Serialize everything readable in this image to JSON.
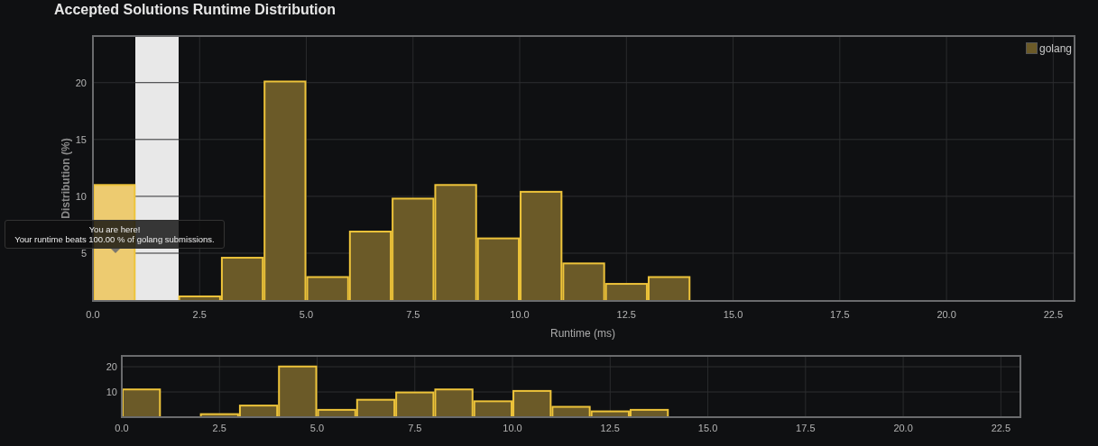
{
  "title": "Accepted Solutions Runtime Distribution",
  "tooltip": {
    "heading": "You are here!",
    "text": "Your runtime beats 100.00 % of golang submissions."
  },
  "chart": {
    "chart_data": {
      "type": "bar",
      "xlabel": "Runtime (ms)",
      "ylabel": "Distribution (%)",
      "grid": true,
      "x": [
        0.5,
        2.5,
        3.5,
        4.5,
        5.5,
        6.5,
        7.5,
        8.5,
        9.5,
        10.5,
        11.5,
        12.5,
        13.5
      ],
      "series": [
        {
          "name": "golang",
          "color": "#6b5a28",
          "values": [
            null,
            1.2,
            4.6,
            20.1,
            2.9,
            6.9,
            9.8,
            11,
            6.3,
            10.4,
            4.1,
            2.3,
            2.9
          ]
        },
        {
          "color": "#edcb70",
          "values": [
            11,
            null,
            null,
            null,
            null,
            null,
            null,
            null,
            null,
            null,
            null,
            null,
            null
          ]
        }
      ],
      "xlim": [
        0,
        23
      ],
      "ylim": [
        0.8,
        24.1
      ],
      "xticks": [
        {
          "value": 0,
          "label": "0.0"
        },
        {
          "value": 2.5,
          "label": "2.5"
        },
        {
          "value": 5,
          "label": "5.0"
        },
        {
          "value": 7.5,
          "label": "7.5"
        },
        {
          "value": 10,
          "label": "10.0"
        },
        {
          "value": 12.5,
          "label": "12.5"
        },
        {
          "value": 15,
          "label": "15.0"
        },
        {
          "value": 17.5,
          "label": "17.5"
        },
        {
          "value": 20,
          "label": "20.0"
        },
        {
          "value": 22.5,
          "label": "22.5"
        }
      ],
      "yticks": [
        5,
        10,
        15,
        20
      ]
    }
  },
  "navigator": {
    "chart_data": {
      "type": "bar",
      "grid": true,
      "x": [
        0.5,
        2.5,
        3.5,
        4.5,
        5.5,
        6.5,
        7.5,
        8.5,
        9.5,
        10.5,
        11.5,
        12.5,
        13.5
      ],
      "series": [
        {
          "color": "#6b5a28",
          "values": [
            11,
            1.2,
            4.6,
            20.1,
            2.9,
            6.9,
            9.8,
            11,
            6.3,
            10.4,
            4.1,
            2.3,
            2.9
          ]
        }
      ],
      "xlim": [
        0,
        23
      ],
      "ylim": [
        0,
        24.3
      ],
      "xticks": [
        {
          "value": 0,
          "label": "0.0"
        },
        {
          "value": 2.5,
          "label": "2.5"
        },
        {
          "value": 5,
          "label": "5.0"
        },
        {
          "value": 7.5,
          "label": "7.5"
        },
        {
          "value": 10,
          "label": "10.0"
        },
        {
          "value": 12.5,
          "label": "12.5"
        },
        {
          "value": 15,
          "label": "15.0"
        },
        {
          "value": 17.5,
          "label": "17.5"
        },
        {
          "value": 20,
          "label": "20.0"
        },
        {
          "value": 22.5,
          "label": "22.5"
        }
      ],
      "yticks": [
        10,
        20
      ]
    }
  }
}
